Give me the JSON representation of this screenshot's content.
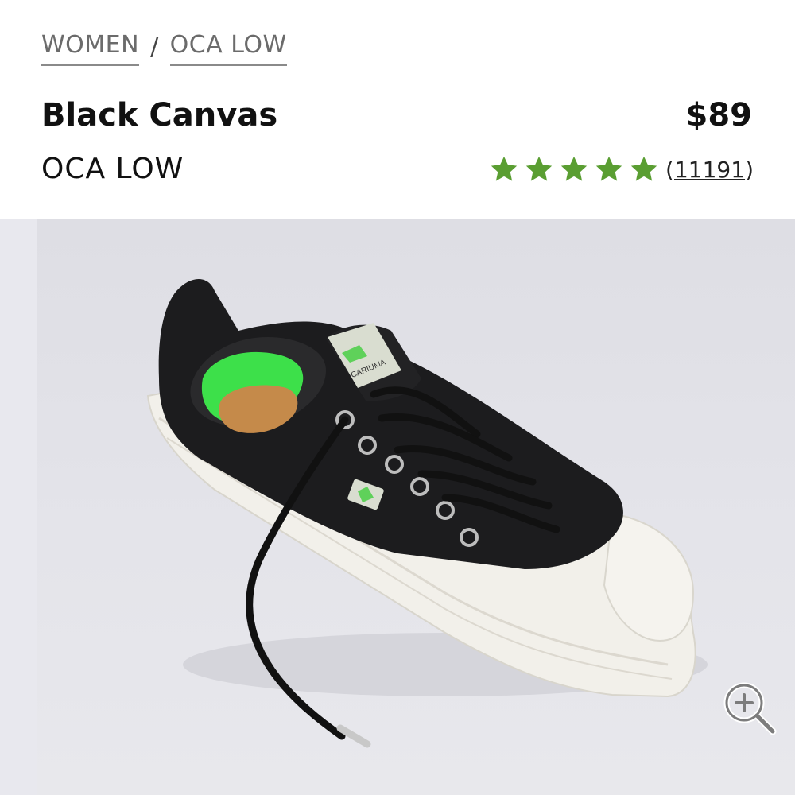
{
  "breadcrumb": {
    "items": [
      "WOMEN",
      "OCA LOW"
    ],
    "separator": "/"
  },
  "product": {
    "name": "Black Canvas",
    "price": "$89",
    "collection": "OCA LOW",
    "rating": {
      "stars": 5,
      "max_stars": 5,
      "review_count_prefix": "(",
      "review_count": "11191",
      "review_count_suffix": ")",
      "star_color": "#5a9e32"
    }
  },
  "image": {
    "icon": "zoom-in-icon",
    "logo_text": "CARIUMA"
  },
  "colors": {
    "accent_green": "#5a9e32",
    "insole_green": "#3de04a",
    "shoe_black": "#1c1c1e",
    "sole_white": "#f2f0ea"
  }
}
